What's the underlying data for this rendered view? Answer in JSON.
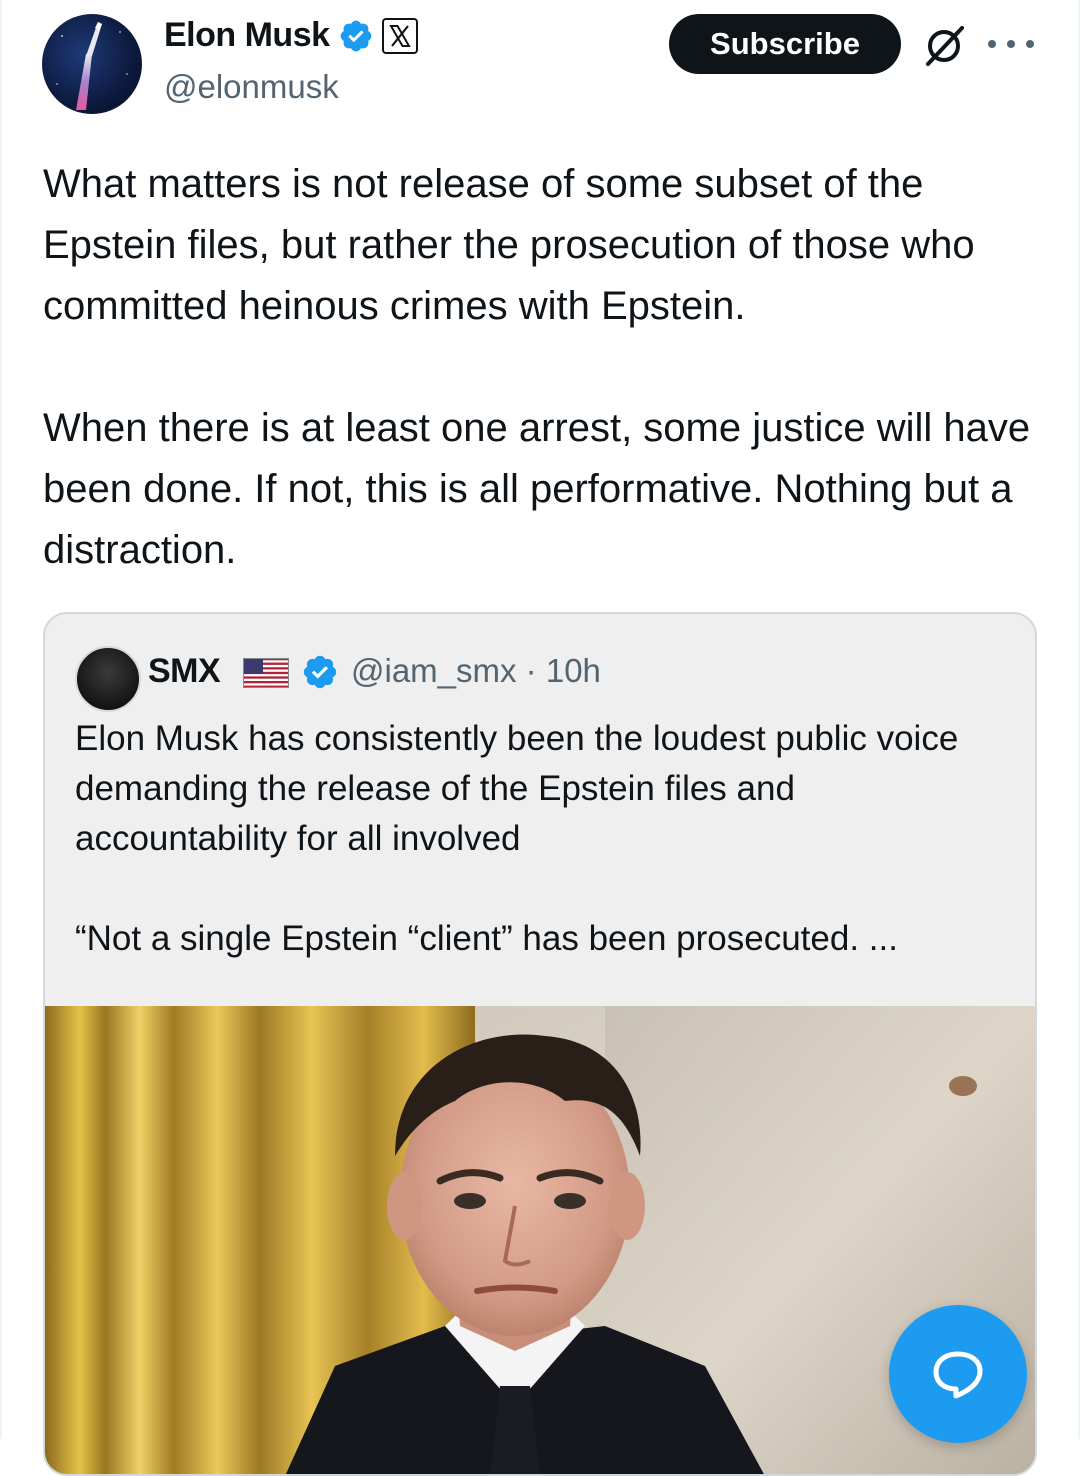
{
  "author": {
    "display_name": "Elon Musk",
    "handle": "@elonmusk",
    "verified": true,
    "affiliation_badge": "x-logo-icon"
  },
  "header_actions": {
    "subscribe_label": "Subscribe",
    "grok_icon": "grok-icon",
    "more_icon": "more-icon"
  },
  "tweet": {
    "text": "What matters is not release of some subset of the Epstein files, but rather the prosecution of those who committed heinous crimes with Epstein.\n\nWhen there is at least one arrest, some justice will have been done. If not, this is all performative. Nothing but a distraction."
  },
  "quoted_tweet": {
    "display_name": "SMX",
    "flag": "us-flag-icon",
    "verified": true,
    "handle_time": "@iam_smx · 10h",
    "text": "Elon Musk has consistently been the loudest public voice demanding the release of the Epstein files and accountability for all involved\n\n“Not a single Epstein “client” has been prosecuted. ...",
    "media": "photo-of-elon-musk"
  },
  "fab": {
    "icon": "compose-reply-icon"
  },
  "colors": {
    "primary_text": "#0f1419",
    "secondary_text": "#536471",
    "accent": "#1d9bf0",
    "border": "#cfd9de",
    "quote_bg": "#efefef"
  }
}
